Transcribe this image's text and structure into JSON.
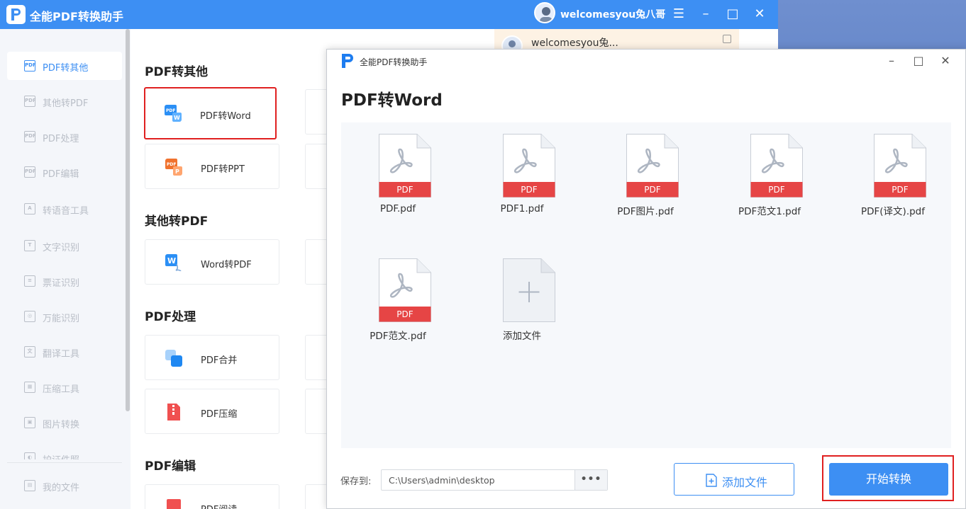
{
  "main_window": {
    "app_name": "全能PDF转换助手",
    "user_name": "welcomesyou兔八哥",
    "sidebar": {
      "items": [
        {
          "label": "PDF转其他",
          "icon_text": "PDF",
          "active": true
        },
        {
          "label": "其他转PDF",
          "icon_text": "PDF"
        },
        {
          "label": "PDF处理",
          "icon_text": "PDF"
        },
        {
          "label": "PDF编辑",
          "icon_text": "PDF"
        },
        {
          "label": "转语音工具",
          "icon_text": "A"
        },
        {
          "label": "文字识别",
          "icon_text": "T"
        },
        {
          "label": "票证识别",
          "icon_text": "≡"
        },
        {
          "label": "万能识别",
          "icon_text": "◎"
        },
        {
          "label": "翻译工具",
          "icon_text": "文"
        },
        {
          "label": "压缩工具",
          "icon_text": "▦"
        },
        {
          "label": "图片转换",
          "icon_text": "▣"
        },
        {
          "label": "护证件照",
          "icon_text": "◐"
        }
      ],
      "bottom_item": {
        "label": "我的文件",
        "icon_text": "▤"
      }
    },
    "sections": [
      {
        "title": "PDF转其他",
        "cards": [
          "PDF转Word",
          "PDF转PPT"
        ]
      },
      {
        "title": "其他转PDF",
        "cards": [
          "Word转PDF"
        ]
      },
      {
        "title": "PDF处理",
        "cards": [
          "PDF合并",
          "PDF压缩"
        ]
      },
      {
        "title": "PDF编辑",
        "cards": [
          "PDF阅读"
        ]
      }
    ],
    "user_popup": {
      "name": "welcomesyou兔..."
    }
  },
  "dialog": {
    "app_name": "全能PDF转换助手",
    "heading": "PDF转Word",
    "pdf_badge": "PDF",
    "files": [
      {
        "name": "PDF.pdf"
      },
      {
        "name": "PDF1.pdf"
      },
      {
        "name": "PDF图片.pdf"
      },
      {
        "name": "PDF范文1.pdf"
      },
      {
        "name": "PDF(译文).pdf"
      },
      {
        "name": "PDF范文.pdf"
      }
    ],
    "add_file_tile": "添加文件",
    "save_to_label": "保存到:",
    "save_path": "C:\\Users\\admin\\desktop",
    "browse_label": "•••",
    "add_file_button": "添加文件",
    "start_button": "开始转换"
  },
  "colors": {
    "accent": "#3d8ff3",
    "highlight": "#e02020",
    "pdf_red": "#e64545"
  },
  "icons": {
    "minimize": "–",
    "maximize": "□",
    "close": "✕",
    "menu": "☰"
  }
}
